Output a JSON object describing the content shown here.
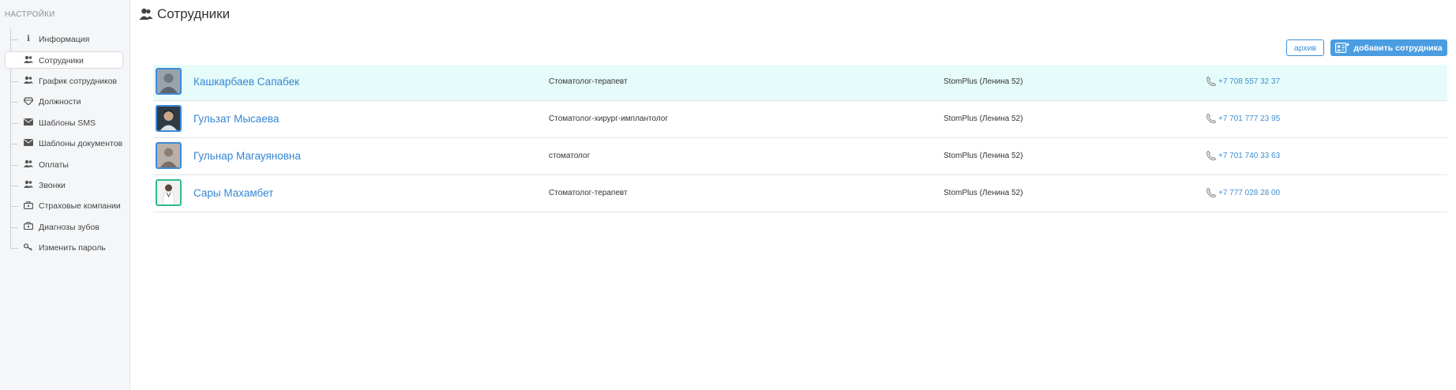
{
  "sidebar": {
    "title": "НАСТРОЙКИ",
    "items": [
      {
        "label": "Информация",
        "icon": "info-icon",
        "active": false
      },
      {
        "label": "Сотрудники",
        "icon": "users-icon",
        "active": true
      },
      {
        "label": "График сотрудников",
        "icon": "users-icon",
        "active": false
      },
      {
        "label": "Должности",
        "icon": "diamond-icon",
        "active": false
      },
      {
        "label": "Шаблоны SMS",
        "icon": "envelope-icon",
        "active": false
      },
      {
        "label": "Шаблоны документов",
        "icon": "envelope-icon",
        "active": false
      },
      {
        "label": "Оплаты",
        "icon": "users-icon",
        "active": false
      },
      {
        "label": "Звонки",
        "icon": "users-icon",
        "active": false
      },
      {
        "label": "Страховые компании",
        "icon": "briefcase-icon",
        "active": false
      },
      {
        "label": "Диагнозы зубов",
        "icon": "briefcase-icon",
        "active": false
      },
      {
        "label": "Изменить пароль",
        "icon": "key-icon",
        "active": false
      }
    ]
  },
  "header": {
    "title": "Сотрудники",
    "icon": "users-icon"
  },
  "toolbar": {
    "archive_label": "архив",
    "add_label": "добавить сотрудника"
  },
  "employees": [
    {
      "name": "Кашкарбаев Сапабек",
      "position": "Стоматолог-терапевт",
      "branch": "StomPlus (Ленина 52)",
      "phone": "+7 708 557 32 37",
      "highlight": true
    },
    {
      "name": "Гульзат Мысаева",
      "position": "Стоматолог-хирург-имплантолог",
      "branch": "StomPlus (Ленина 52)",
      "phone": "+7 701 777 23 95",
      "highlight": false
    },
    {
      "name": "Гульнар Магауяновна",
      "position": "стоматолог",
      "branch": "StomPlus (Ленина 52)",
      "phone": "+7 701 740 33 63",
      "highlight": false
    },
    {
      "name": "Сары Махамбет",
      "position": "Стоматолог-терапевт",
      "branch": "StomPlus (Ленина 52)",
      "phone": "+7 777 028 28 00",
      "highlight": false
    }
  ],
  "colors": {
    "accent": "#3486d3",
    "button": "#4a9de0",
    "row_highlight": "#e6fcfa",
    "avatar_border": "#3c8ad8",
    "avatar_border_alt": "#2ebd8a"
  }
}
